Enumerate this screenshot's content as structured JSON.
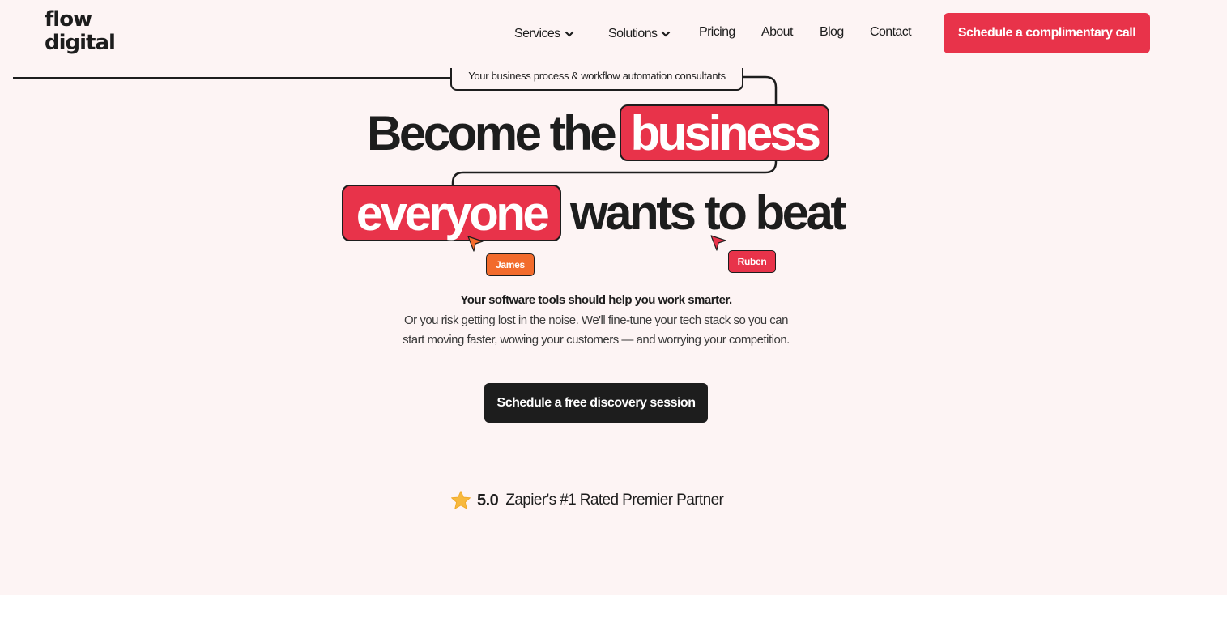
{
  "logo": {
    "line1": "flow",
    "line2": "digital"
  },
  "nav": {
    "items": [
      {
        "label": "Services",
        "has_dropdown": true
      },
      {
        "label": "Solutions",
        "has_dropdown": true
      },
      {
        "label": "Pricing",
        "has_dropdown": false
      },
      {
        "label": "About",
        "has_dropdown": false
      },
      {
        "label": "Blog",
        "has_dropdown": false
      },
      {
        "label": "Contact",
        "has_dropdown": false
      }
    ],
    "cta_label": "Schedule a complimentary call"
  },
  "hero": {
    "tagline": "Your business process & workflow automation consultants",
    "headline_part1": "Become the",
    "headline_highlight1": "business",
    "headline_highlight2": "everyone",
    "headline_part2": "wants to beat",
    "cursors": [
      {
        "name": "James",
        "color": "#f26b2c"
      },
      {
        "name": "Ruben",
        "color": "#e8334a"
      }
    ],
    "sub_bold": "Your software tools should help you work smarter.",
    "sub_line1": "Or you risk getting lost in the noise. We'll fine-tune your tech stack so you can",
    "sub_line2": "start moving faster, wowing your customers — and worrying your competition.",
    "cta_label": "Schedule a free discovery session"
  },
  "rating": {
    "icon": "star-icon",
    "score": "5.0",
    "label": "Zapier's #1 Rated Premier Partner"
  },
  "colors": {
    "accent": "#e8334a",
    "accent_orange": "#f26b2c",
    "dark": "#1d1d1d",
    "background": "#fdf4f4",
    "star": "#f7b93e"
  }
}
